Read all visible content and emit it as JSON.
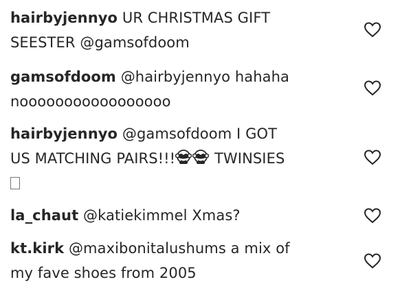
{
  "comments": [
    {
      "username": "hairbyjennyo",
      "text_line1": "UR CHRISTMAS GIFT",
      "text_line2": "SEESTER @gamsofdoom",
      "like_icon": "heart-outline-icon"
    },
    {
      "username": "gamsofdoom",
      "mention": "@hairbyjennyo",
      "text_line1": "hahaha",
      "text_line2": "nooooooooooooooooo",
      "like_icon": "heart-outline-icon"
    },
    {
      "username": "hairbyjennyo",
      "mention": "@gamsofdoom",
      "text_line1": "I GOT",
      "text_line2a": "US MATCHING PAIRS!!!",
      "emojis": [
        "see-no-evil-monkey-icon",
        "see-no-evil-monkey-icon"
      ],
      "text_line2b": "TWINSIES",
      "text_line3": "missing-glyph-box",
      "like_icon": "heart-outline-icon"
    },
    {
      "username": "la_chaut",
      "mention": "@katiekimmel",
      "text_line1": "Xmas?",
      "like_icon": "heart-outline-icon"
    },
    {
      "username": "kt.kirk",
      "mention": "@maxibonitalushums",
      "text_line1": "a mix of",
      "text_line2": "my fave shoes from 2005",
      "like_icon": "heart-outline-icon"
    }
  ],
  "colors": {
    "text": "#262626",
    "heart_stroke": "#262626",
    "background": "#ffffff"
  }
}
